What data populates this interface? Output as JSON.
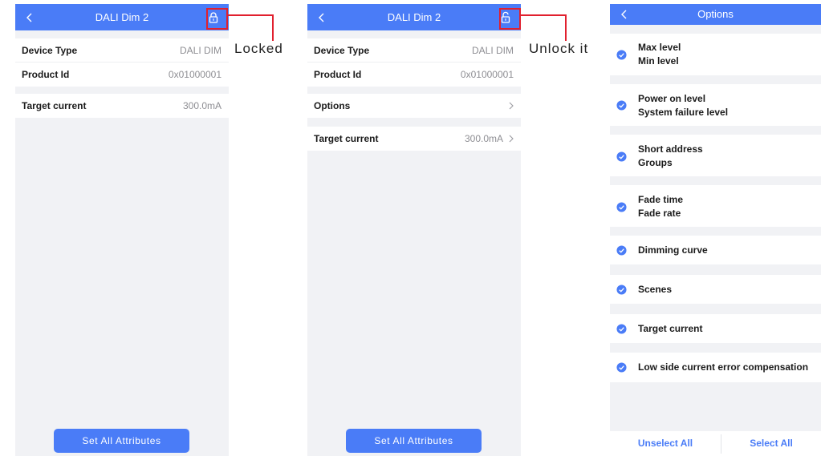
{
  "screens": {
    "locked": {
      "title": "DALI Dim 2",
      "info_rows": [
        {
          "label": "Device Type",
          "value": "DALI DIM"
        },
        {
          "label": "Product Id",
          "value": "0x01000001"
        }
      ],
      "target_row": {
        "label": "Target current",
        "value": "300.0mA"
      },
      "button": "Set All Attributes"
    },
    "unlocked": {
      "title": "DALI Dim 2",
      "info_rows": [
        {
          "label": "Device Type",
          "value": "DALI DIM"
        },
        {
          "label": "Product Id",
          "value": "0x01000001"
        }
      ],
      "options_row": {
        "label": "Options"
      },
      "target_row": {
        "label": "Target current",
        "value": "300.0mA"
      },
      "button": "Set All Attributes"
    },
    "options": {
      "title": "Options",
      "items": [
        {
          "lines": [
            "Max level",
            "Min level"
          ],
          "checked": true
        },
        {
          "lines": [
            "Power on level",
            "System failure level"
          ],
          "checked": true
        },
        {
          "lines": [
            "Short address",
            "Groups"
          ],
          "checked": true
        },
        {
          "lines": [
            "Fade time",
            "Fade rate"
          ],
          "checked": true
        },
        {
          "lines": [
            "Dimming curve"
          ],
          "checked": true
        },
        {
          "lines": [
            "Scenes"
          ],
          "checked": true
        },
        {
          "lines": [
            "Target current"
          ],
          "checked": true
        },
        {
          "lines": [
            "Low side current error compensation"
          ],
          "checked": true
        }
      ],
      "unselect_all": "Unselect All",
      "select_all": "Select All"
    }
  },
  "annotations": {
    "locked": "Locked",
    "unlock": "Unlock it"
  },
  "colors": {
    "accent": "#4a7cf7",
    "callout": "#e1202e",
    "background": "#f1f2f5"
  },
  "icons": {
    "back": "chevron-left-icon",
    "locked": "lock-closed-icon",
    "unlocked": "lock-open-icon",
    "check": "check-circle-icon",
    "chevron": "chevron-right-icon"
  }
}
